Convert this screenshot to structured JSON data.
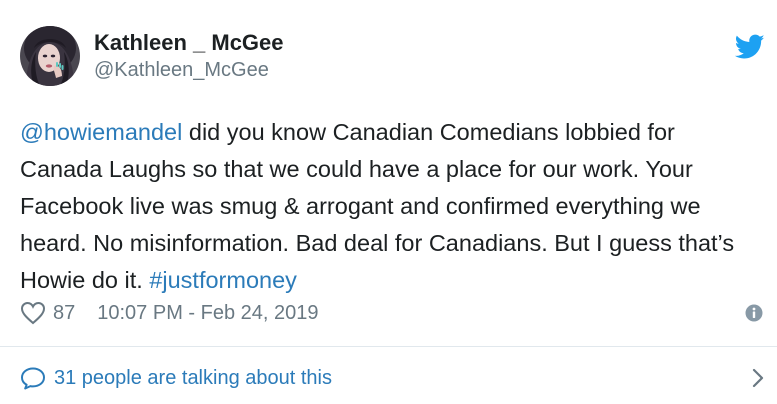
{
  "author": {
    "display_name": "Kathleen _ McGee",
    "handle": "@Kathleen_McGee"
  },
  "tweet": {
    "mention": "@howiemandel",
    "body": " did you know  Canadian Comedians lobbied for Canada Laughs so that we could have a place for our work. Your Facebook live was smug & arrogant and confirmed everything we heard. No misinformation. Bad deal for Canadians. But I guess that’s Howie do it. ",
    "hashtag": "#justformoney"
  },
  "meta": {
    "like_count": "87",
    "timestamp": "10:07 PM - Feb 24, 2019"
  },
  "footer": {
    "talking_label": "31 people are talking about this"
  },
  "icons": {
    "brand": "twitter-bird-icon",
    "like": "heart-icon",
    "info": "info-icon",
    "reply": "speech-bubble-icon",
    "more": "chevron-right-icon"
  },
  "colors": {
    "link": "#2b7bb9",
    "brand": "#1da1f2",
    "secondary_text": "#697882",
    "primary_text": "#1c2022",
    "divider": "#e1e8ed"
  }
}
